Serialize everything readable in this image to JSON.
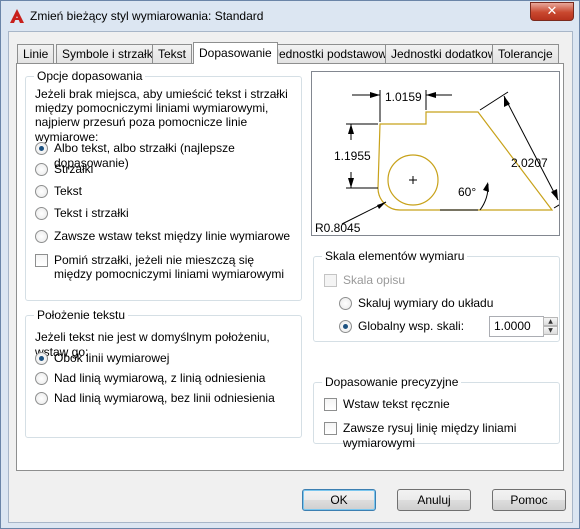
{
  "window": {
    "title": "Zmień bieżący styl wymiarowania: Standard",
    "close_glyph": "✕"
  },
  "tabs": [
    "Linie",
    "Symbole i strzałki",
    "Tekst",
    "Dopasowanie",
    "Jednostki podstawowe",
    "Jednostki dodatkowe",
    "Tolerancje"
  ],
  "fit_options": {
    "legend": "Opcje dopasowania",
    "description": [
      "Jeżeli brak miejsca, aby umieścić tekst i strzałki",
      "między pomocniczymi liniami wymiarowymi,",
      "najpierw przesuń poza pomocnicze linie wymiarowe:"
    ],
    "radios": [
      {
        "label": "Albo tekst, albo strzałki (najlepsze dopasowanie)",
        "checked": true
      },
      {
        "label": "Strzałki",
        "checked": false
      },
      {
        "label": "Tekst",
        "checked": false
      },
      {
        "label": "Tekst i strzałki",
        "checked": false
      },
      {
        "label": "Zawsze wstaw tekst między linie wymiarowe",
        "checked": false
      }
    ],
    "suppress_check": {
      "line1": "Pomiń strzałki, jeżeli nie mieszczą się",
      "line2": "między pomocniczymi liniami wymiarowymi",
      "checked": false
    }
  },
  "text_placement": {
    "legend": "Położenie tekstu",
    "description": "Jeżeli tekst nie jest w domyślnym położeniu, wstaw go:",
    "radios": [
      {
        "label": "Obok linii wymiarowej",
        "checked": true
      },
      {
        "label": "Nad linią wymiarową, z linią odniesienia",
        "checked": false
      },
      {
        "label": "Nad linią wymiarową, bez linii odniesienia",
        "checked": false
      }
    ]
  },
  "preview": {
    "dim_top": "1.0159",
    "dim_left": "1.1955",
    "dim_right": "2.0207",
    "dim_angle": "60°",
    "dim_radius": "R0.8045"
  },
  "scale": {
    "legend": "Skala elementów wymiaru",
    "annotative": "Skala opisu",
    "scale_to_layout": "Skaluj wymiary do układu",
    "overall_scale_label": "Globalny wsp. skali:",
    "overall_scale_value": "1.0000"
  },
  "fine_tuning": {
    "legend": "Dopasowanie precyzyjne",
    "manual": "Wstaw tekst ręcznie",
    "always_draw": "Zawsze rysuj linię między liniami wymiarowymi"
  },
  "buttons": {
    "ok": "OK",
    "cancel": "Anuluj",
    "help": "Pomoc"
  },
  "colors": {
    "accent": "#1c5180",
    "preview_shape": "#c8a21a"
  }
}
